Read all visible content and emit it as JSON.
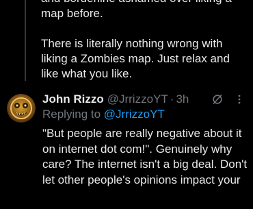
{
  "previous_tweet": {
    "paragraphs": [
      "and borderline ashamed over liking a map before.",
      "There is literally nothing wrong with liking a Zombies map. Just relax and like what you like."
    ]
  },
  "reply": {
    "author_name": "John Rizzo",
    "author_handle": "@JrrizzoYT",
    "separator": "·",
    "timestamp": "3h",
    "replying_to_prefix": "Replying to ",
    "replying_to_handle": "@JrrizzoYT",
    "body": "\"But people are really negative about it on internet dot com!\". Genuinely why care? The internet isn't a big deal. Don't let other people's opinions impact your"
  },
  "icons": {
    "avatar": "avatar-icon",
    "grok": "grok-icon",
    "more": "more-options-icon"
  },
  "colors": {
    "background": "#000000",
    "text_primary": "#e7e9ea",
    "text_secondary": "#71767b",
    "link": "#1d9bf0",
    "thread_line": "#333639"
  }
}
